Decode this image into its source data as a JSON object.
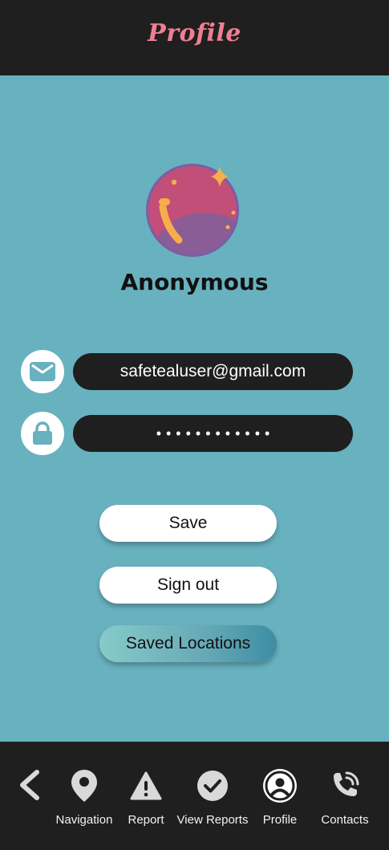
{
  "header": {
    "title": "Profile"
  },
  "profile": {
    "username": "Anonymous",
    "email": "safetealuser@gmail.com",
    "password_mask": "••••••••••••"
  },
  "actions": {
    "save_label": "Save",
    "sign_out_label": "Sign out",
    "saved_locations_label": "Saved Locations"
  },
  "bottom_nav": {
    "items": [
      {
        "label": "Navigation",
        "icon": "location-pin-icon"
      },
      {
        "label": "Report",
        "icon": "warning-icon"
      },
      {
        "label": "View Reports",
        "icon": "checkmark-circle-icon"
      },
      {
        "label": "Profile",
        "icon": "user-circle-icon",
        "active": true
      },
      {
        "label": "Contacts",
        "icon": "phone-call-icon"
      }
    ]
  },
  "colors": {
    "background": "#68b1bf",
    "bar": "#1f1f1f",
    "title": "#f07e93",
    "field": "#1f1f1f",
    "button": "#ffffff"
  }
}
